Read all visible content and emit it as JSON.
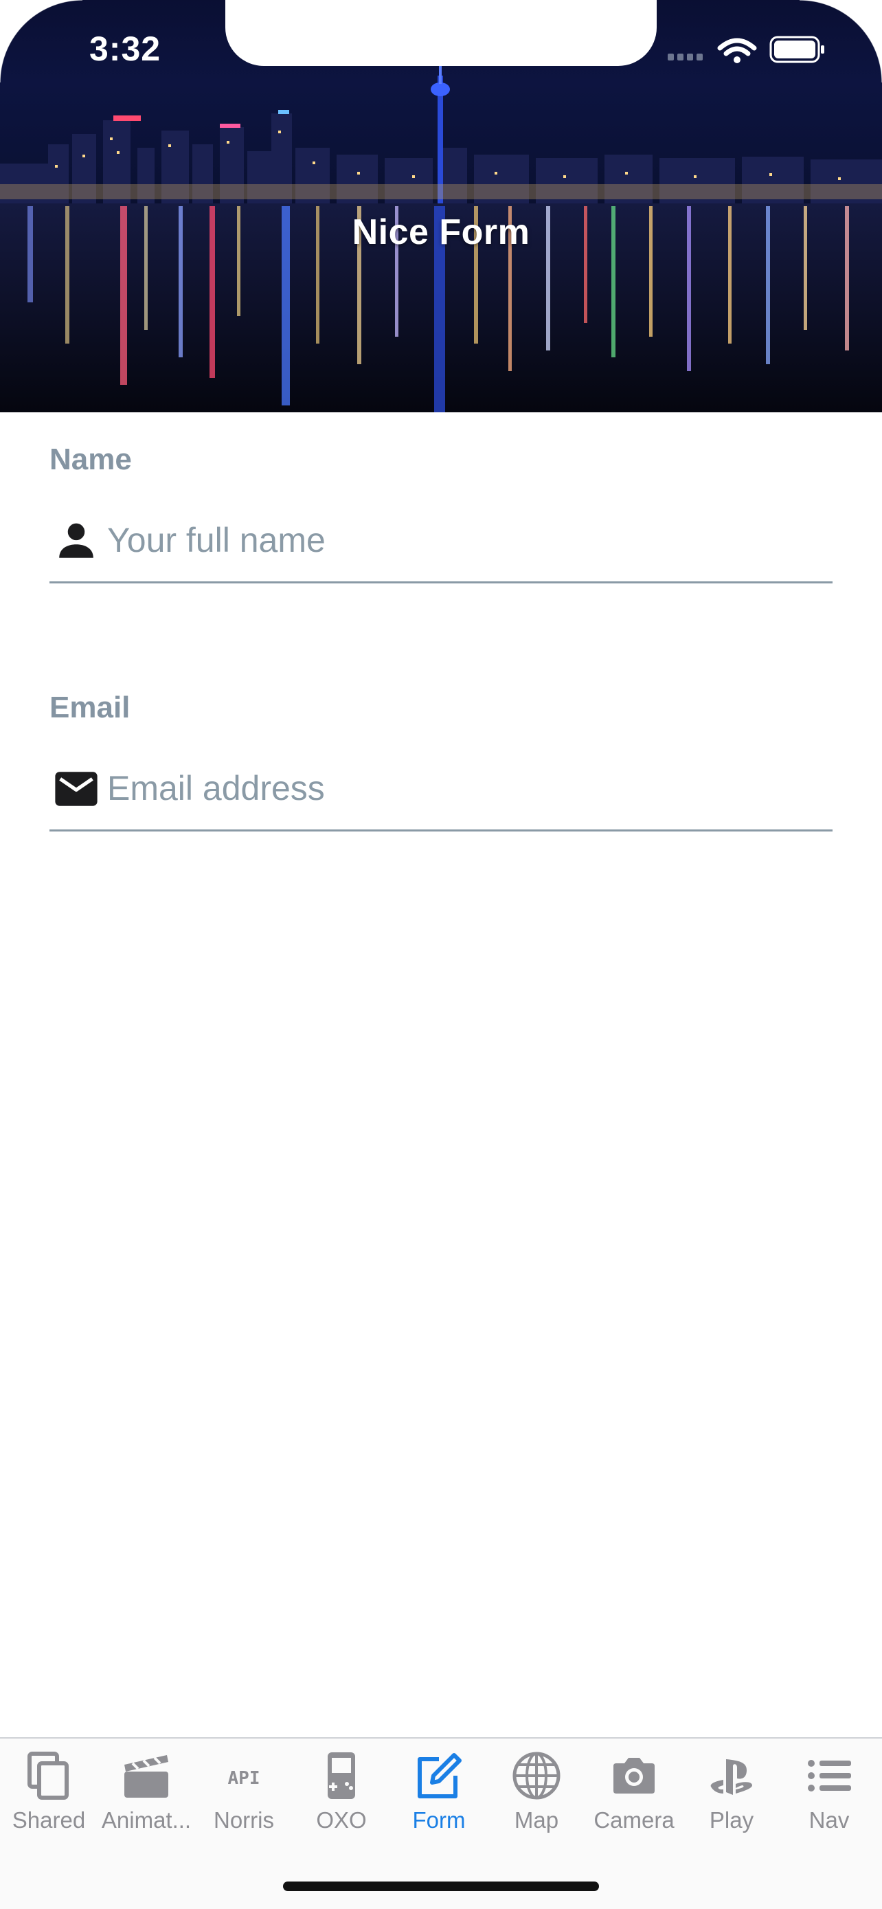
{
  "status_bar": {
    "time": "3:32"
  },
  "header": {
    "title": "Nice Form"
  },
  "form": {
    "name": {
      "label": "Name",
      "placeholder": "Your full name",
      "value": "",
      "icon": "person-icon"
    },
    "email": {
      "label": "Email",
      "placeholder": "Email address",
      "value": "",
      "icon": "envelope-icon"
    }
  },
  "tabbar": {
    "active_color": "#1a7fe5",
    "inactive_color": "#8e8e93",
    "items": [
      {
        "label": "Shared",
        "icon": "copy-icon",
        "active": false
      },
      {
        "label": "Animat...",
        "icon": "clapperboard-icon",
        "active": false
      },
      {
        "label": "Norris",
        "icon": "api-icon",
        "active": false
      },
      {
        "label": "OXO",
        "icon": "gameboy-icon",
        "active": false
      },
      {
        "label": "Form",
        "icon": "edit-icon",
        "active": true
      },
      {
        "label": "Map",
        "icon": "globe-icon",
        "active": false
      },
      {
        "label": "Camera",
        "icon": "camera-icon",
        "active": false
      },
      {
        "label": "Play",
        "icon": "playstation-icon",
        "active": false
      },
      {
        "label": "Nav",
        "icon": "list-icon",
        "active": false
      }
    ]
  }
}
